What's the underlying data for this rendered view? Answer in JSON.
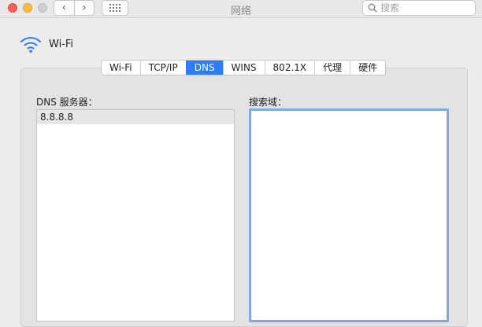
{
  "window": {
    "title": "网络"
  },
  "toolbar": {
    "back_glyph": "‹",
    "forward_glyph": "›",
    "search_placeholder": "搜索"
  },
  "interface": {
    "name": "Wi-Fi"
  },
  "tabs": [
    {
      "label": "Wi-Fi",
      "active": false
    },
    {
      "label": "TCP/IP",
      "active": false
    },
    {
      "label": "DNS",
      "active": true
    },
    {
      "label": "WINS",
      "active": false
    },
    {
      "label": "802.1X",
      "active": false
    },
    {
      "label": "代理",
      "active": false
    },
    {
      "label": "硬件",
      "active": false
    }
  ],
  "dns": {
    "servers_label": "DNS 服务器：",
    "servers": [
      "8.8.8.8"
    ],
    "search_domains_label": "搜索域：",
    "search_domains": []
  },
  "colors": {
    "accent": "#2e7cf6",
    "wifi_icon": "#3b82f0",
    "focus_ring": "#7ea8ea"
  },
  "icons": [
    "close-icon",
    "minimize-icon",
    "zoom-icon",
    "chevron-left-icon",
    "chevron-right-icon",
    "grid-icon",
    "search-icon",
    "wifi-icon"
  ]
}
